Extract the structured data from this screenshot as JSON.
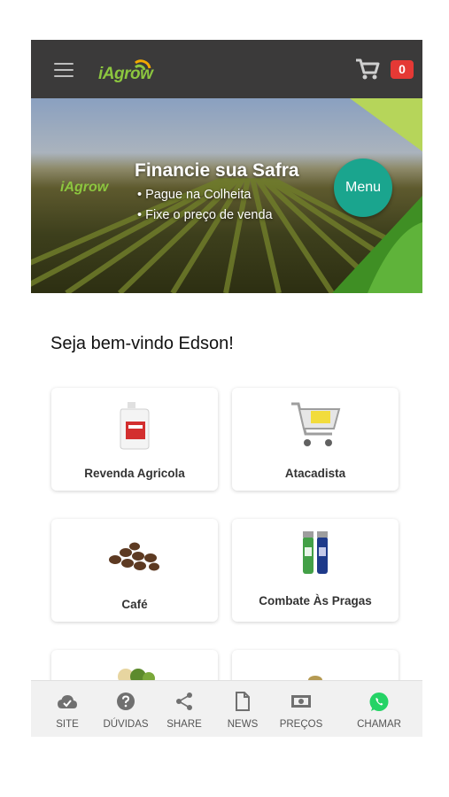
{
  "header": {
    "logo_text": "iAgrow",
    "cart_count": "0"
  },
  "banner": {
    "menu_label": "Menu",
    "title": "Financie sua Safra",
    "bullets": [
      "• Pague na Colheita",
      "• Fixe o preço de venda"
    ],
    "logo_text": "iAgrow"
  },
  "welcome": "Seja bem-vindo Edson!",
  "categories": [
    {
      "label": "Revenda Agricola",
      "icon": "jerrycan-icon"
    },
    {
      "label": "Atacadista",
      "icon": "shopping-cart-icon"
    },
    {
      "label": "Café",
      "icon": "coffee-beans-icon"
    },
    {
      "label": "Combate Às Pragas",
      "icon": "pesticide-cans-icon"
    },
    {
      "label": "",
      "icon": "vegetables-icon"
    },
    {
      "label": "",
      "icon": "product-icon"
    }
  ],
  "bottom_nav": [
    {
      "label": "SITE",
      "icon": "cloud-check-icon"
    },
    {
      "label": "DÚVIDAS",
      "icon": "help-icon"
    },
    {
      "label": "SHARE",
      "icon": "share-icon"
    },
    {
      "label": "NEWS",
      "icon": "document-icon"
    },
    {
      "label": "PREÇOS",
      "icon": "money-icon"
    },
    {
      "label": "CHAMAR",
      "icon": "whatsapp-icon"
    }
  ],
  "colors": {
    "appbar": "#3b3a3a",
    "brand_green": "#8cc63f",
    "menu_teal": "#1aa58e",
    "badge_red": "#e53935",
    "whatsapp_green": "#25d366"
  }
}
